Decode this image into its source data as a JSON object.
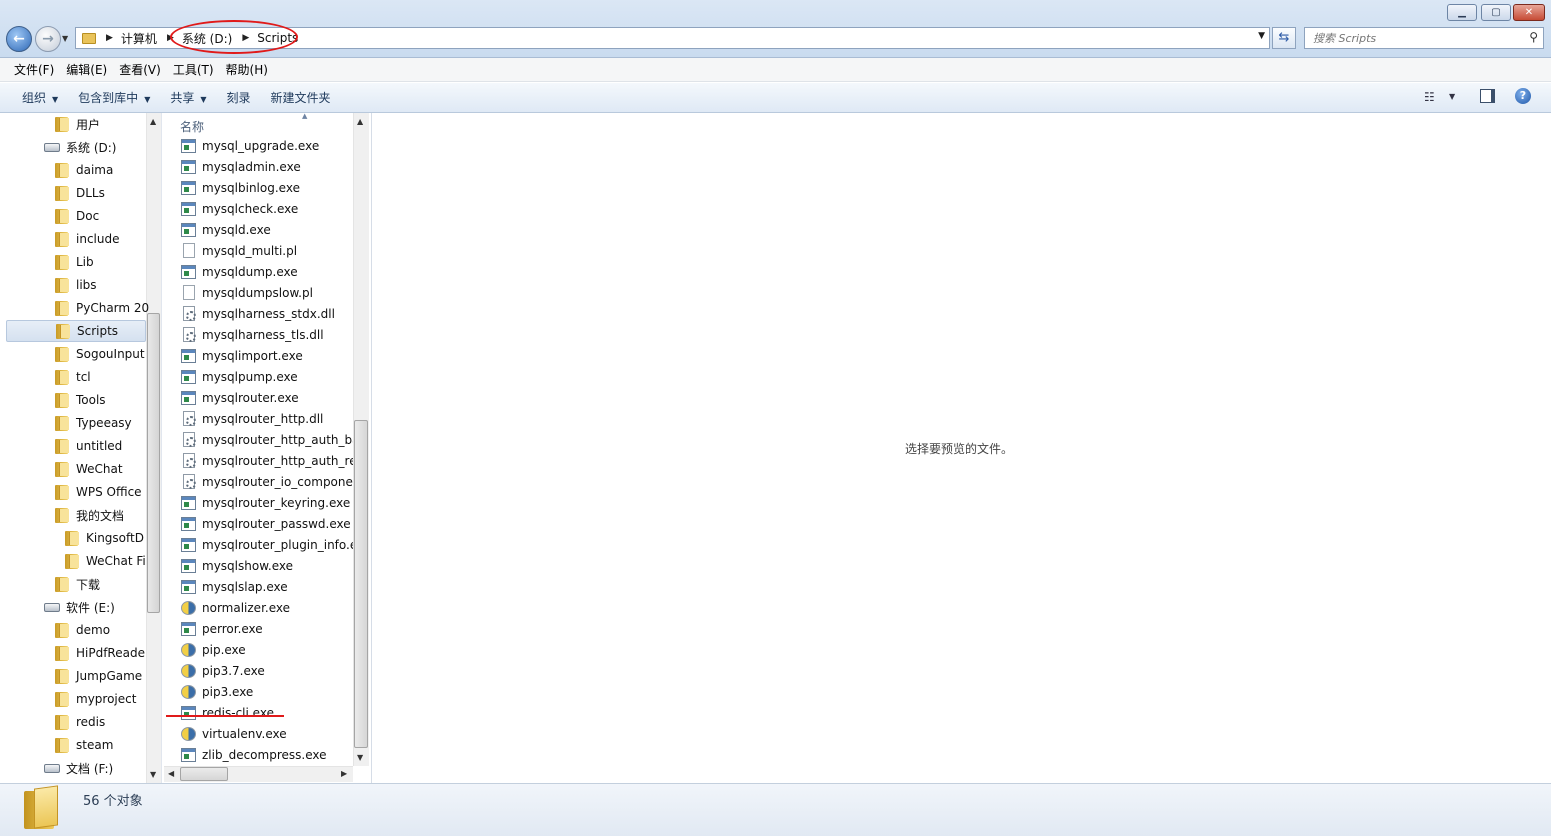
{
  "window": {
    "minimize": "▁",
    "maximize": "▢",
    "close": "✕"
  },
  "address": {
    "crumbs": [
      "计算机",
      "系统 (D:)",
      "Scripts"
    ]
  },
  "search": {
    "placeholder": "搜索 Scripts"
  },
  "menu": [
    "文件(F)",
    "编辑(E)",
    "查看(V)",
    "工具(T)",
    "帮助(H)"
  ],
  "toolbar": {
    "organize": "组织",
    "include_in_library": "包含到库中",
    "share": "共享",
    "burn": "刻录",
    "new_folder": "新建文件夹"
  },
  "nav": {
    "items": [
      {
        "label": "用户",
        "type": "folder",
        "level": 2
      },
      {
        "label": "系统 (D:)",
        "type": "drive",
        "level": 1
      },
      {
        "label": "daima",
        "type": "folder",
        "level": 2
      },
      {
        "label": "DLLs",
        "type": "folder",
        "level": 2
      },
      {
        "label": "Doc",
        "type": "folder",
        "level": 2
      },
      {
        "label": "include",
        "type": "folder",
        "level": 2
      },
      {
        "label": "Lib",
        "type": "folder",
        "level": 2
      },
      {
        "label": "libs",
        "type": "folder",
        "level": 2
      },
      {
        "label": "PyCharm 20",
        "type": "folder",
        "level": 2
      },
      {
        "label": "Scripts",
        "type": "folder",
        "level": 2,
        "selected": true
      },
      {
        "label": "SogouInput",
        "type": "folder",
        "level": 2
      },
      {
        "label": "tcl",
        "type": "folder",
        "level": 2
      },
      {
        "label": "Tools",
        "type": "folder",
        "level": 2
      },
      {
        "label": "Typeeasy",
        "type": "folder",
        "level": 2
      },
      {
        "label": "untitled",
        "type": "folder",
        "level": 2
      },
      {
        "label": "WeChat",
        "type": "folder",
        "level": 2
      },
      {
        "label": "WPS Office",
        "type": "folder",
        "level": 2
      },
      {
        "label": "我的文档",
        "type": "folder",
        "level": 2
      },
      {
        "label": "KingsoftD",
        "type": "folder",
        "level": 3
      },
      {
        "label": "WeChat Fi",
        "type": "folder",
        "level": 3
      },
      {
        "label": "下载",
        "type": "folder",
        "level": 2
      },
      {
        "label": "软件 (E:)",
        "type": "drive",
        "level": 1
      },
      {
        "label": "demo",
        "type": "folder",
        "level": 2
      },
      {
        "label": "HiPdfReade",
        "type": "folder",
        "level": 2
      },
      {
        "label": "JumpGame",
        "type": "folder",
        "level": 2
      },
      {
        "label": "myproject",
        "type": "folder",
        "level": 2
      },
      {
        "label": "redis",
        "type": "folder",
        "level": 2
      },
      {
        "label": "steam",
        "type": "folder",
        "level": 2
      },
      {
        "label": "文档 (F:)",
        "type": "drive",
        "level": 1
      }
    ]
  },
  "files": {
    "column_name": "名称",
    "items": [
      {
        "name": "mysql_upgrade.exe",
        "icon": "exe"
      },
      {
        "name": "mysqladmin.exe",
        "icon": "exe"
      },
      {
        "name": "mysqlbinlog.exe",
        "icon": "exe"
      },
      {
        "name": "mysqlcheck.exe",
        "icon": "exe"
      },
      {
        "name": "mysqld.exe",
        "icon": "exe"
      },
      {
        "name": "mysqld_multi.pl",
        "icon": "pl"
      },
      {
        "name": "mysqldump.exe",
        "icon": "exe"
      },
      {
        "name": "mysqldumpslow.pl",
        "icon": "pl"
      },
      {
        "name": "mysqlharness_stdx.dll",
        "icon": "dll"
      },
      {
        "name": "mysqlharness_tls.dll",
        "icon": "dll"
      },
      {
        "name": "mysqlimport.exe",
        "icon": "exe"
      },
      {
        "name": "mysqlpump.exe",
        "icon": "exe"
      },
      {
        "name": "mysqlrouter.exe",
        "icon": "exe"
      },
      {
        "name": "mysqlrouter_http.dll",
        "icon": "dll"
      },
      {
        "name": "mysqlrouter_http_auth_backend.dll",
        "icon": "dll"
      },
      {
        "name": "mysqlrouter_http_auth_realm.dll",
        "icon": "dll"
      },
      {
        "name": "mysqlrouter_io_component.dll",
        "icon": "dll"
      },
      {
        "name": "mysqlrouter_keyring.exe",
        "icon": "exe"
      },
      {
        "name": "mysqlrouter_passwd.exe",
        "icon": "exe"
      },
      {
        "name": "mysqlrouter_plugin_info.exe",
        "icon": "exe"
      },
      {
        "name": "mysqlshow.exe",
        "icon": "exe"
      },
      {
        "name": "mysqlslap.exe",
        "icon": "exe"
      },
      {
        "name": "normalizer.exe",
        "icon": "py"
      },
      {
        "name": "perror.exe",
        "icon": "exe"
      },
      {
        "name": "pip.exe",
        "icon": "py"
      },
      {
        "name": "pip3.7.exe",
        "icon": "py"
      },
      {
        "name": "pip3.exe",
        "icon": "py"
      },
      {
        "name": "redis-cli.exe",
        "icon": "exe"
      },
      {
        "name": "virtualenv.exe",
        "icon": "py"
      },
      {
        "name": "zlib_decompress.exe",
        "icon": "exe"
      }
    ]
  },
  "preview": {
    "message": "选择要预览的文件。"
  },
  "status": {
    "count": "56 个对象"
  },
  "colors": {
    "annotation": "#e01a1a",
    "accent": "#1e395b"
  }
}
